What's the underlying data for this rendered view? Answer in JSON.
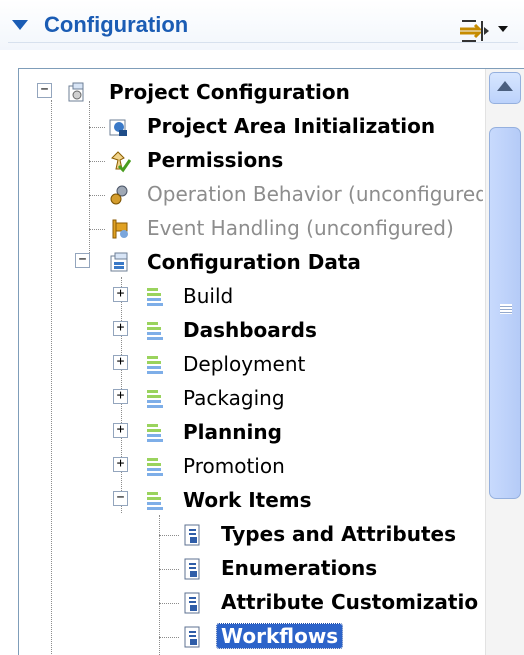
{
  "header": {
    "title": "Configuration",
    "collapse_icon": "triangle-down-icon",
    "toolbar_icon": "layout-arrows-icon",
    "toolbar_dropdown_icon": "chevron-down-icon"
  },
  "tree": {
    "items": [
      {
        "label": "Project Configuration",
        "icon": "project-config-icon",
        "state": "expanded"
      },
      {
        "label": "Project Area Initialization",
        "icon": "project-init-icon"
      },
      {
        "label": "Permissions",
        "icon": "permissions-icon"
      },
      {
        "label": "Operation Behavior (unconfigured)",
        "icon": "gear-icon"
      },
      {
        "label": "Event Handling (unconfigured)",
        "icon": "event-icon"
      },
      {
        "label": "Configuration Data",
        "icon": "config-data-icon",
        "state": "expanded"
      },
      {
        "label": "Build",
        "icon": "data-folder-icon",
        "state": "collapsed"
      },
      {
        "label": "Dashboards",
        "icon": "data-folder-icon",
        "state": "collapsed"
      },
      {
        "label": "Deployment",
        "icon": "data-folder-icon",
        "state": "collapsed"
      },
      {
        "label": "Packaging",
        "icon": "data-folder-icon",
        "state": "collapsed"
      },
      {
        "label": "Planning",
        "icon": "data-folder-icon",
        "state": "collapsed"
      },
      {
        "label": "Promotion",
        "icon": "data-folder-icon",
        "state": "collapsed"
      },
      {
        "label": "Work Items",
        "icon": "data-folder-icon",
        "state": "expanded"
      },
      {
        "label": "Types and Attributes",
        "icon": "document-gear-icon"
      },
      {
        "label": "Enumerations",
        "icon": "document-gear-icon"
      },
      {
        "label": "Attribute Customizatio",
        "icon": "document-gear-icon"
      },
      {
        "label": "Workflows",
        "icon": "document-gear-icon",
        "selected": true
      }
    ]
  },
  "colors": {
    "accent": "#1b5cb4",
    "selection": "#2c63c9",
    "muted_text": "#8d8d8d",
    "scrollbar": "#bcd2fb"
  }
}
